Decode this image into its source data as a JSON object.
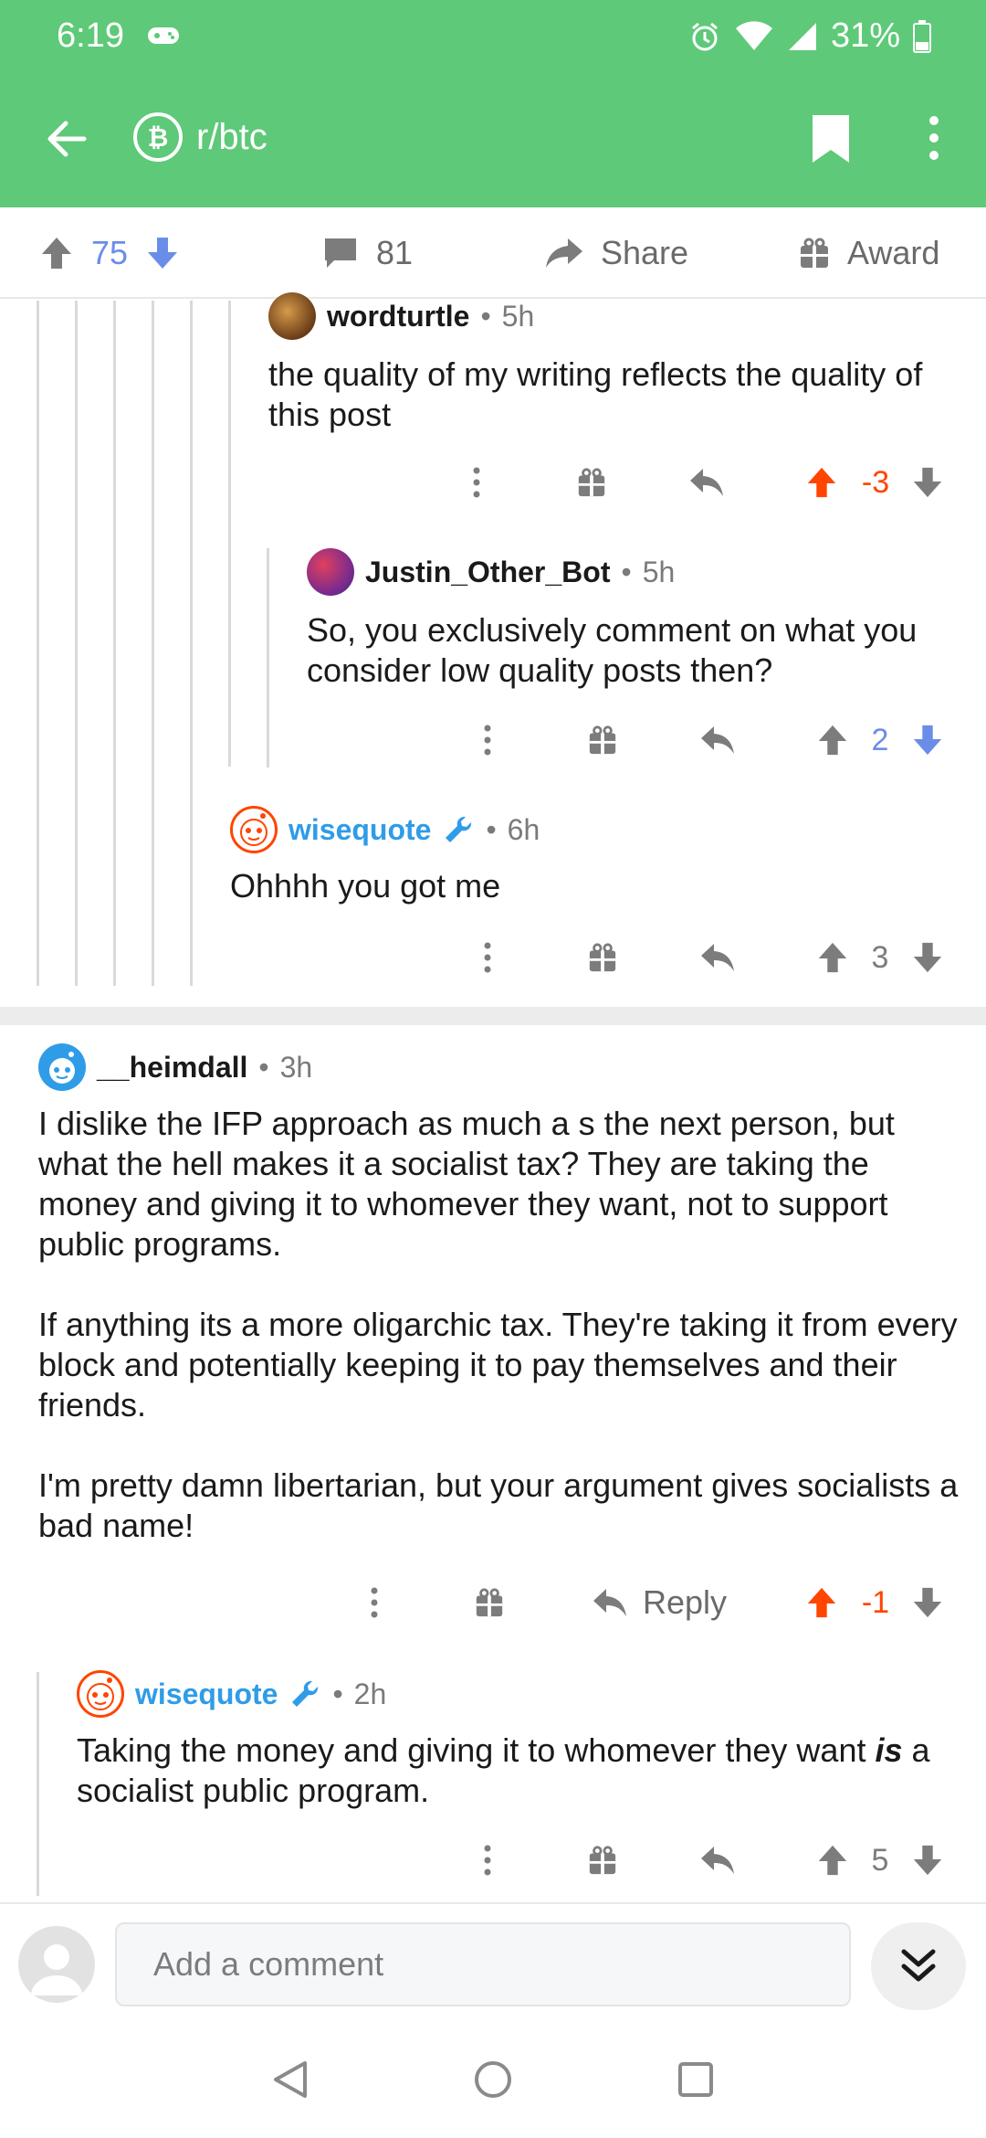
{
  "status_bar": {
    "time": "6:19",
    "battery": "31%"
  },
  "app_bar": {
    "subreddit": "r/btc"
  },
  "post_actions": {
    "upvotes": "75",
    "comments": "81",
    "share_label": "Share",
    "award_label": "Award"
  },
  "comments": [
    {
      "author": "wordturtle",
      "age": "5h",
      "body": "the quality of my writing reflects the quality of this post",
      "score": "-3"
    },
    {
      "author": "Justin_Other_Bot",
      "age": "5h",
      "body": "So, you exclusively comment on what you consider low quality posts then?",
      "score": "2"
    },
    {
      "author": "wisequote",
      "age": "6h",
      "body": "Ohhhh you got me",
      "score": "3"
    },
    {
      "author": "__heimdall",
      "age": "3h",
      "body_paragraphs": [
        "I dislike the IFP approach as much a s the next person, but what the hell makes it a socialist tax?  They are taking the money and giving it to whomever they want, not to support public programs.",
        "If anything its a more oligarchic tax.  They're taking it from every block and potentially keeping it to pay themselves and their friends.",
        "I'm pretty damn libertarian, but your argument gives socialists a bad name!"
      ],
      "reply_label": "Reply",
      "score": "-1"
    },
    {
      "author": "wisequote",
      "age": "2h",
      "body_before": "Taking the money and giving it to whomever they want ",
      "body_emph": "is",
      "body_after": " a socialist public program.",
      "score": "5"
    }
  ],
  "compose": {
    "placeholder": "Add a comment"
  },
  "colors": {
    "brand_green": "#5ec978",
    "upvote": "#ff4500",
    "downvote_blue": "#6a8ee8",
    "mod_blue": "#2f9ce8"
  },
  "icons": [
    "back-arrow-icon",
    "bitcoin-icon",
    "bookmark-icon",
    "more-vert-icon",
    "upvote-icon",
    "downvote-icon",
    "comment-icon",
    "share-icon",
    "gift-icon",
    "reply-icon",
    "wrench-icon",
    "expand-icon",
    "nav-back-icon",
    "nav-home-icon",
    "nav-recents-icon"
  ]
}
